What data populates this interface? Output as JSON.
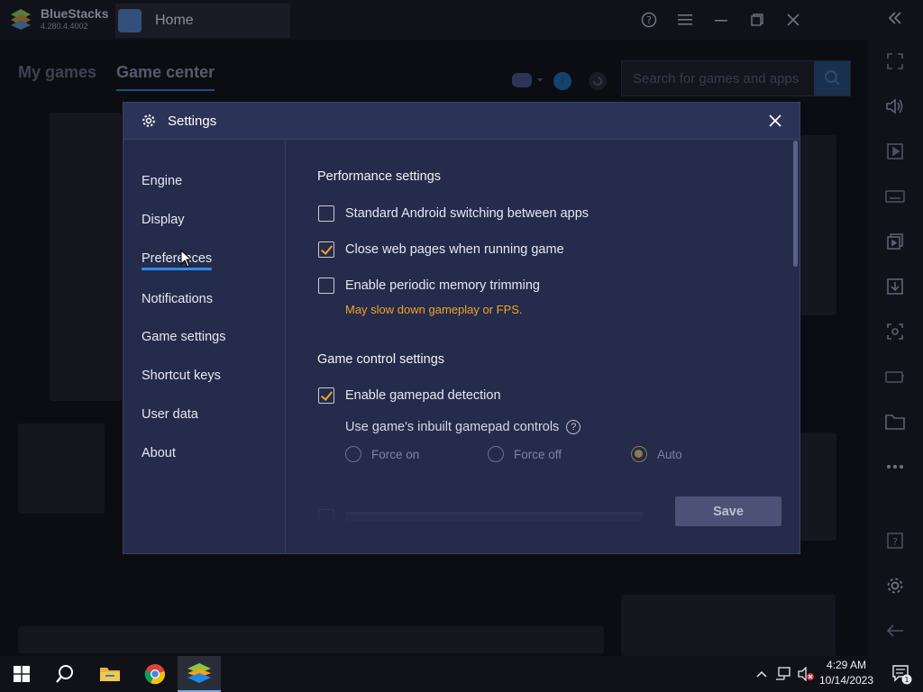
{
  "app": {
    "name": "BlueStacks",
    "version": "4.280.4.4002",
    "tab_label": "Home"
  },
  "background": {
    "tabs": [
      "My games",
      "Game center"
    ],
    "search_placeholder": "Search for games and apps"
  },
  "settings": {
    "title": "Settings",
    "nav": [
      "Engine",
      "Display",
      "Preferences",
      "Notifications",
      "Game settings",
      "Shortcut keys",
      "User data",
      "About"
    ],
    "active_nav": "Preferences",
    "performance": {
      "title": "Performance settings",
      "options": [
        {
          "label": "Standard Android switching between apps",
          "checked": false
        },
        {
          "label": "Close web pages when running game",
          "checked": true
        },
        {
          "label": "Enable periodic memory trimming",
          "checked": false
        }
      ],
      "warning": "May slow down gameplay or FPS."
    },
    "game_control": {
      "title": "Game control settings",
      "gamepad_detection": {
        "label": "Enable gamepad detection",
        "checked": true
      },
      "inbuilt_label": "Use game's inbuilt gamepad controls",
      "radio_options": [
        "Force on",
        "Force off",
        "Auto"
      ],
      "radio_selected": "Auto"
    },
    "save_label": "Save"
  },
  "taskbar": {
    "time": "4:29 AM",
    "date": "10/14/2023",
    "notification_count": "1"
  },
  "colors": {
    "accent_blue": "#2d8bf0",
    "check_orange": "#f2a326",
    "modal_bg": "#252b4a"
  }
}
